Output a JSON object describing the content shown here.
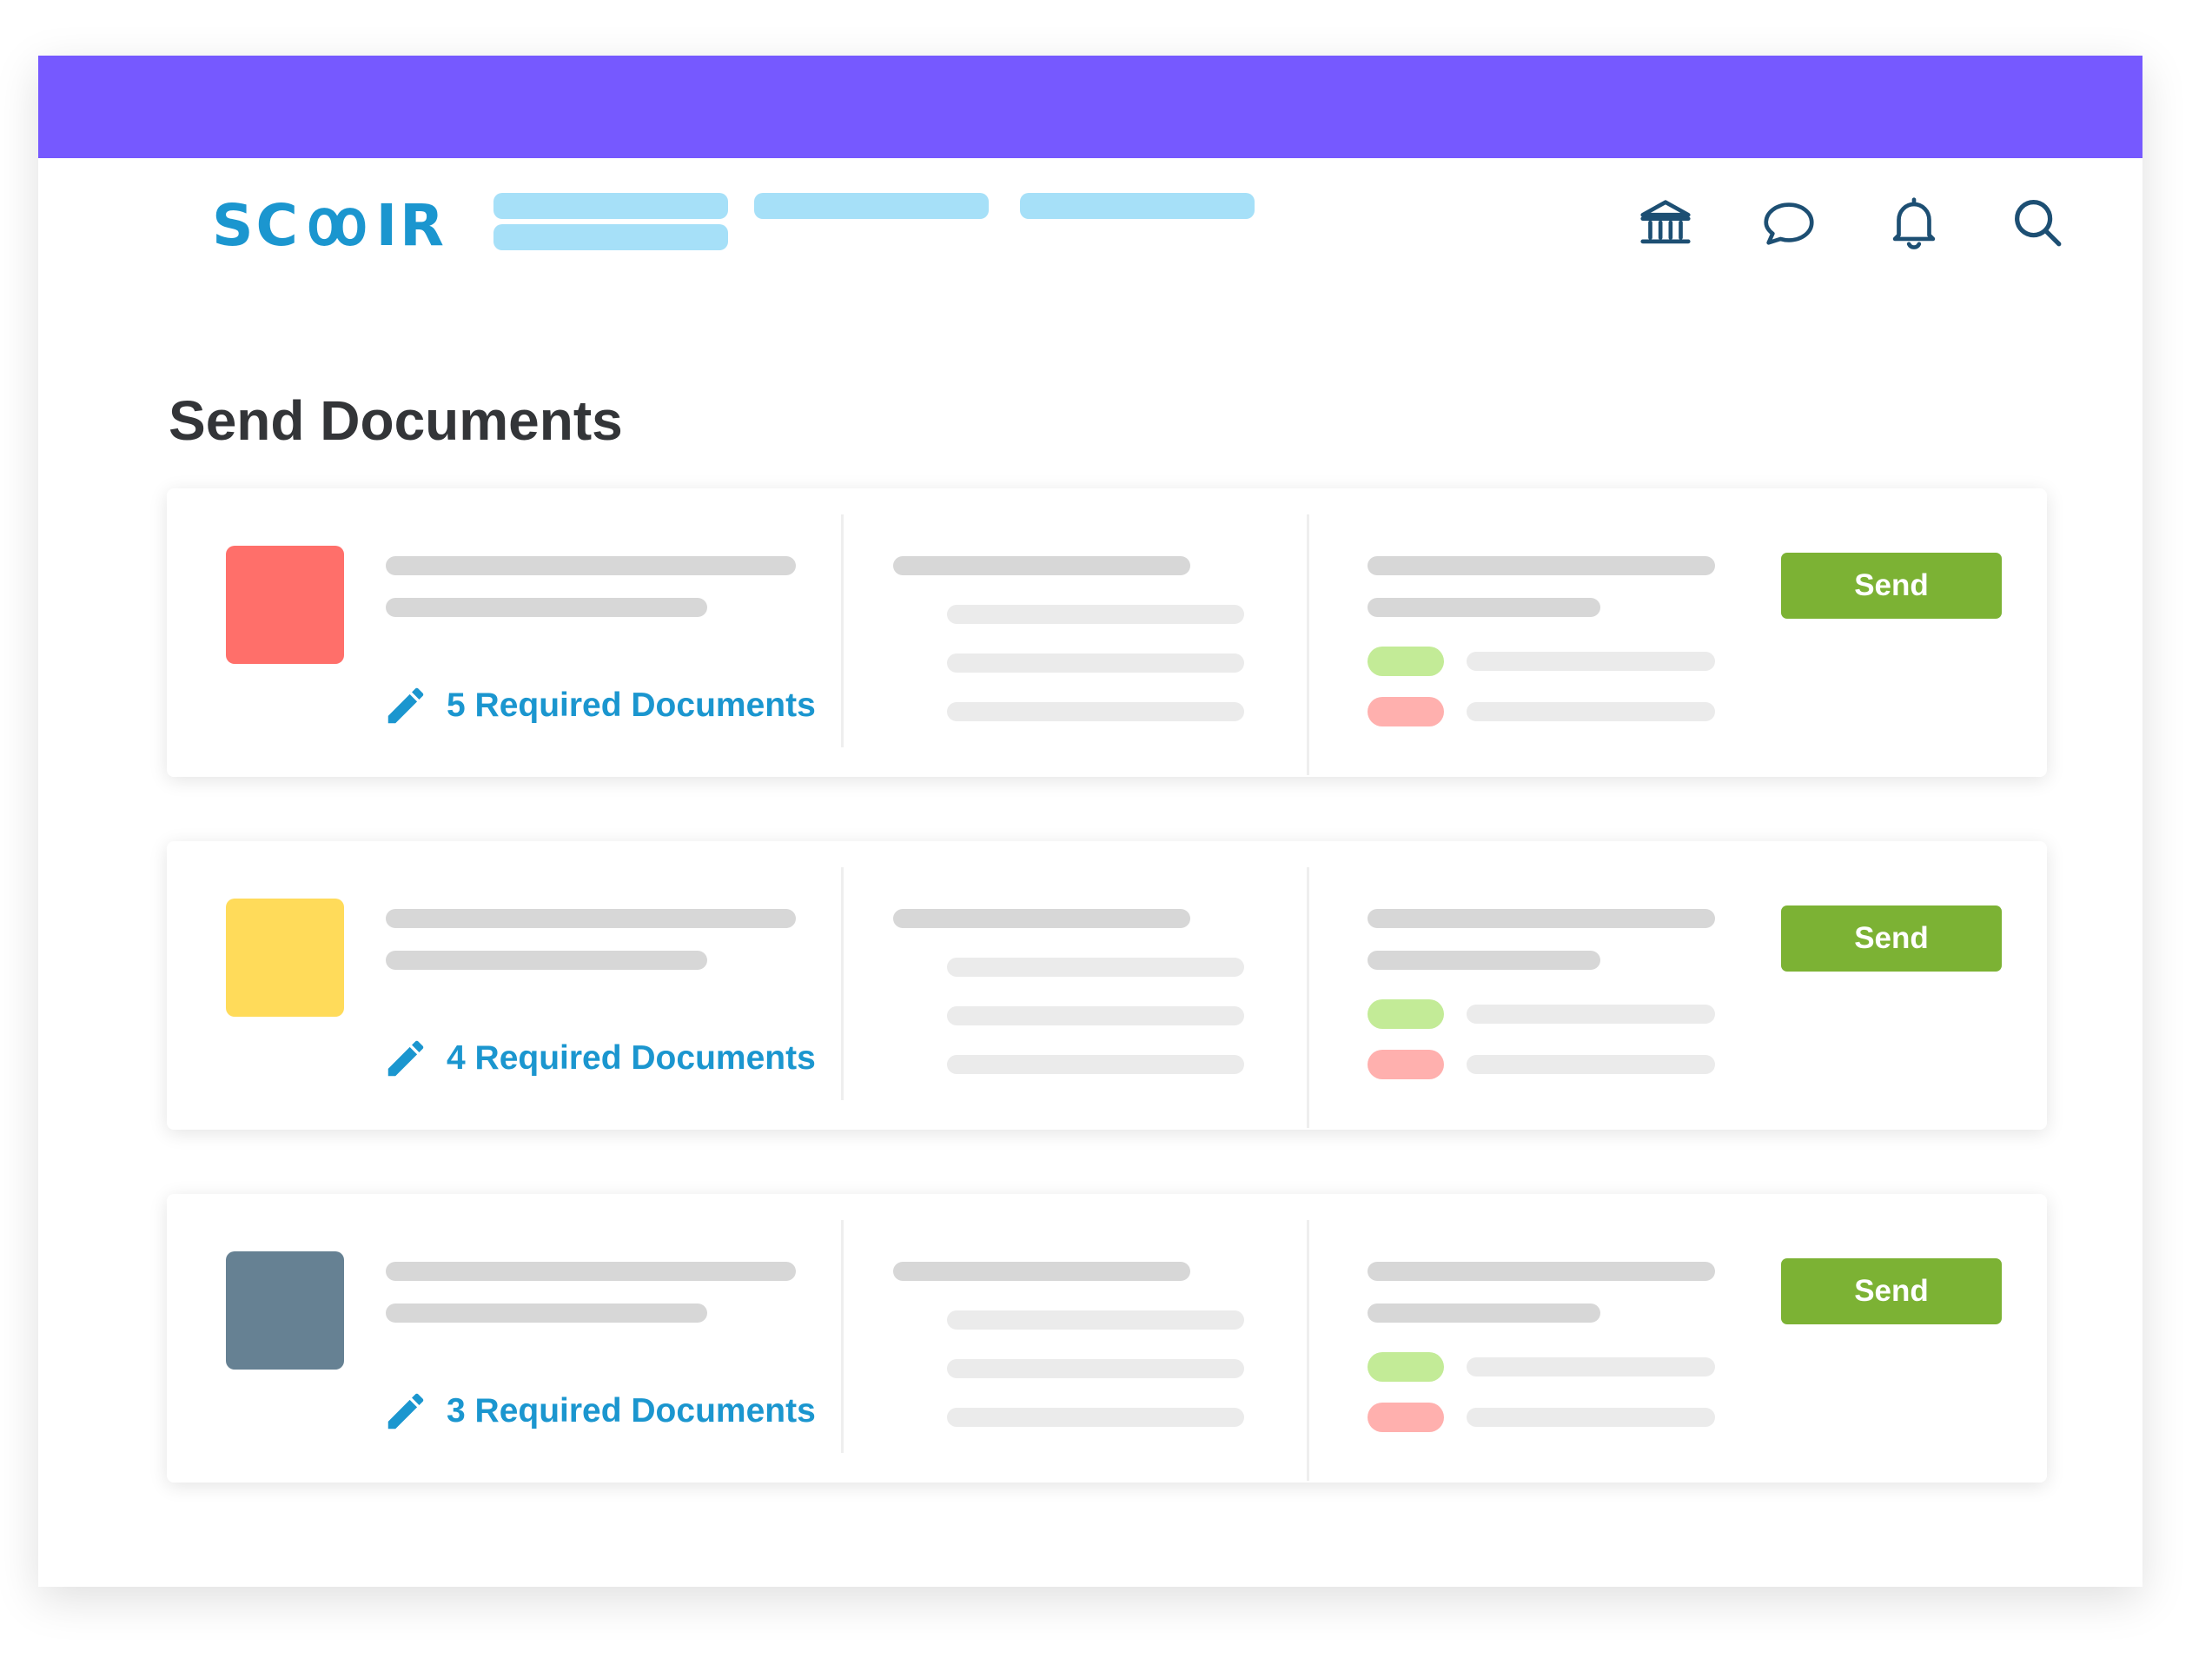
{
  "header": {
    "logo_text": "SCOIR",
    "icons": [
      "bank-icon",
      "chat-bubble-icon",
      "bell-icon",
      "search-icon"
    ]
  },
  "page": {
    "title": "Send Documents"
  },
  "colors": {
    "top_bar": "#7659ff",
    "brand_blue": "#1b96cf",
    "send_green": "#7cb234"
  },
  "cards": [
    {
      "swatch_color": "#ff6f6a",
      "required_label": "5 Required Documents",
      "send_label": "Send"
    },
    {
      "swatch_color": "#ffdb5a",
      "required_label": "4 Required Documents",
      "send_label": "Send"
    },
    {
      "swatch_color": "#668193",
      "required_label": "3 Required Documents",
      "send_label": "Send"
    }
  ]
}
